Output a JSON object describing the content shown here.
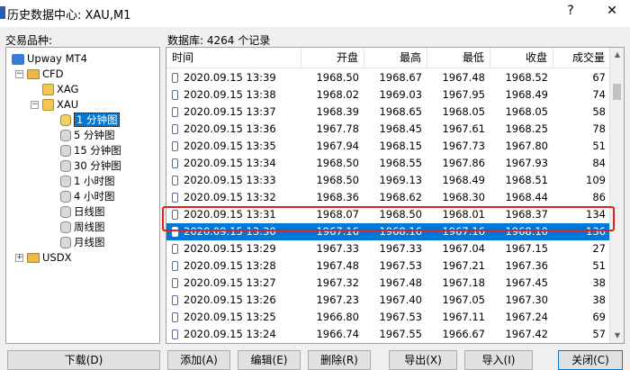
{
  "window": {
    "title": "历史数据中心: XAU,M1",
    "help_label": "?",
    "close_label": "✕"
  },
  "tree": {
    "heading": "交易品种:",
    "root": "Upway MT4",
    "folders": [
      {
        "label": "CFD"
      },
      {
        "label": "XAG"
      },
      {
        "label": "XAU"
      },
      {
        "label": "USDX"
      }
    ],
    "timeframes": [
      "1 分钟图",
      "5 分钟图",
      "15 分钟图",
      "30 分钟图",
      "1 小时图",
      "4 小时图",
      "日线图",
      "周线图",
      "月线图"
    ],
    "selected_timeframe": "1 分钟图"
  },
  "table": {
    "db_label": "数据库: 4264 个记录",
    "columns": [
      "时间",
      "开盘",
      "最高",
      "最低",
      "收盘",
      "成交量"
    ],
    "rows": [
      [
        "2020.09.15 13:39",
        "1968.50",
        "1968.67",
        "1967.48",
        "1968.52",
        "67"
      ],
      [
        "2020.09.15 13:38",
        "1968.02",
        "1969.03",
        "1967.95",
        "1968.49",
        "74"
      ],
      [
        "2020.09.15 13:37",
        "1968.39",
        "1968.65",
        "1968.05",
        "1968.05",
        "58"
      ],
      [
        "2020.09.15 13:36",
        "1967.78",
        "1968.45",
        "1967.61",
        "1968.25",
        "78"
      ],
      [
        "2020.09.15 13:35",
        "1967.94",
        "1968.15",
        "1967.73",
        "1967.80",
        "51"
      ],
      [
        "2020.09.15 13:34",
        "1968.50",
        "1968.55",
        "1967.86",
        "1967.93",
        "84"
      ],
      [
        "2020.09.15 13:33",
        "1968.50",
        "1969.13",
        "1968.49",
        "1968.51",
        "109"
      ],
      [
        "2020.09.15 13:32",
        "1968.36",
        "1968.62",
        "1968.30",
        "1968.44",
        "86"
      ],
      [
        "2020.09.15 13:31",
        "1968.07",
        "1968.50",
        "1968.01",
        "1968.37",
        "134"
      ],
      [
        "2020.09.15 13:30",
        "1967.16",
        "1968.16",
        "1967.16",
        "1968.10",
        "136"
      ],
      [
        "2020.09.15 13:29",
        "1967.33",
        "1967.33",
        "1967.04",
        "1967.15",
        "27"
      ],
      [
        "2020.09.15 13:28",
        "1967.48",
        "1967.53",
        "1967.21",
        "1967.36",
        "51"
      ],
      [
        "2020.09.15 13:27",
        "1967.32",
        "1967.48",
        "1967.18",
        "1967.45",
        "38"
      ],
      [
        "2020.09.15 13:26",
        "1967.23",
        "1967.40",
        "1967.05",
        "1967.30",
        "38"
      ],
      [
        "2020.09.15 13:25",
        "1966.80",
        "1967.53",
        "1967.11",
        "1967.24",
        "69"
      ],
      [
        "2020.09.15 13:24",
        "1966.74",
        "1967.55",
        "1966.67",
        "1967.42",
        "57"
      ],
      [
        "2020.09.15 13:23",
        "1966.74",
        "1966.84",
        "1966.71",
        "1966.75",
        "20"
      ]
    ],
    "selected_index": 9
  },
  "buttons": {
    "download": "下载(D)",
    "add": "添加(A)",
    "edit": "编辑(E)",
    "delete": "删除(R)",
    "export": "导出(X)",
    "import": "导入(I)",
    "close": "关闭(C)"
  },
  "colors": {
    "selection": "#0078d7",
    "highlight_box": "#e02020"
  }
}
